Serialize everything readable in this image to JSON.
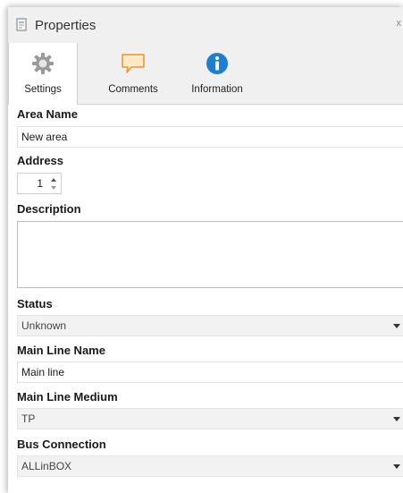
{
  "window": {
    "title": "Properties",
    "close_glyph": "x"
  },
  "tabs": [
    {
      "label": "Settings",
      "icon": "gear-icon",
      "active": true
    },
    {
      "label": "Comments",
      "icon": "speech-bubble-icon",
      "active": false
    },
    {
      "label": "Information",
      "icon": "info-icon",
      "active": false
    }
  ],
  "form": {
    "area_name": {
      "label": "Area Name",
      "value": "New area"
    },
    "address": {
      "label": "Address",
      "value": "1"
    },
    "description": {
      "label": "Description",
      "value": ""
    },
    "status": {
      "label": "Status",
      "value": "Unknown"
    },
    "main_line_name": {
      "label": "Main Line Name",
      "value": "Main line"
    },
    "main_line_medium": {
      "label": "Main Line Medium",
      "value": "TP"
    },
    "bus_connection": {
      "label": "Bus Connection",
      "value": "ALLinBOX"
    }
  },
  "colors": {
    "info_blue": "#1e7fd0",
    "comment_orange": "#e8952e",
    "comment_fill": "#fde9c8"
  }
}
